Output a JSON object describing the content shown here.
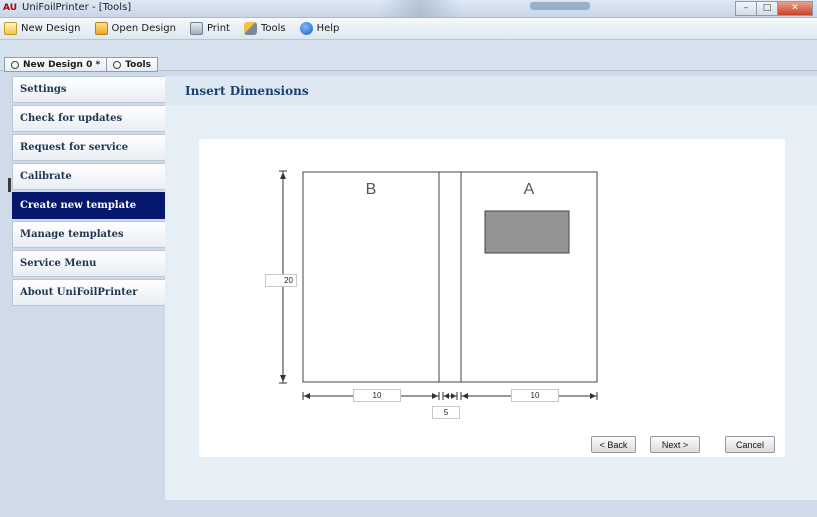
{
  "window": {
    "title": "UniFoilPrinter - [Tools]",
    "logo": "AU"
  },
  "toolbar": {
    "new_design": "New Design",
    "open_design": "Open Design",
    "print": "Print",
    "tools": "Tools",
    "help": "Help"
  },
  "tabs": [
    {
      "label": "New Design 0 *"
    },
    {
      "label": "Tools"
    }
  ],
  "sidebar": {
    "items": [
      {
        "label": "Settings"
      },
      {
        "label": "Check for updates"
      },
      {
        "label": "Request for service"
      },
      {
        "label": "Calibrate"
      },
      {
        "label": "Create new template",
        "active": true
      },
      {
        "label": "Manage templates"
      },
      {
        "label": "Service Menu"
      },
      {
        "label": "About UniFoilPrinter"
      }
    ]
  },
  "main": {
    "title": "Insert Dimensions",
    "diagram": {
      "page_left_label": "B",
      "page_right_label": "A",
      "height_value": "20",
      "left_width_value": "10",
      "spine_width_value": "5",
      "right_width_value": "10"
    },
    "buttons": {
      "back": "< Back",
      "next": "Next >",
      "cancel": "Cancel"
    }
  },
  "colors": {
    "sidebar_active": "#06186d",
    "title_text": "#1d3f6f",
    "foil_area": "#949494"
  }
}
